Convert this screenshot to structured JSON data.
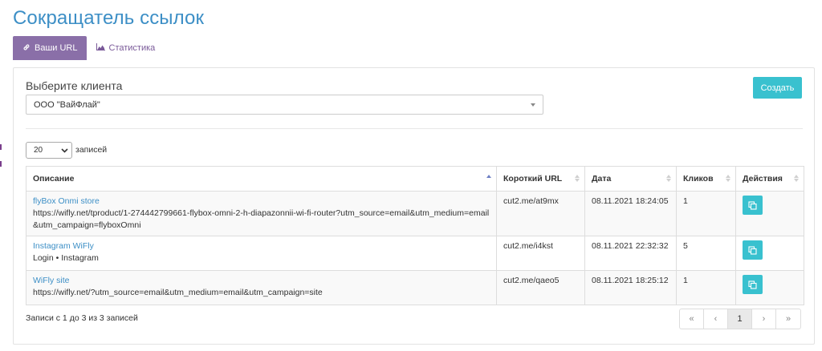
{
  "header": {
    "title": "Сокращатель ссылок"
  },
  "tabs": [
    {
      "label": "Ваши URL",
      "icon": "link-icon",
      "active": true
    },
    {
      "label": "Статистика",
      "icon": "area-chart-icon",
      "active": false
    }
  ],
  "client": {
    "label": "Выберите клиента",
    "selected": "ООО \"ВайФлай\""
  },
  "create_button": {
    "label": "Создать"
  },
  "length": {
    "value": "20",
    "suffix": "записей"
  },
  "table": {
    "columns": [
      {
        "label": "Описание",
        "sorted": "asc"
      },
      {
        "label": "Короткий URL"
      },
      {
        "label": "Дата"
      },
      {
        "label": "Кликов"
      },
      {
        "label": "Действия"
      }
    ],
    "rows": [
      {
        "title": "flyBox Onmi store",
        "desc": "https://wifly.net/tproduct/1-274442799661-flybox-omni-2-h-diapazonnii-wi-fi-router?utm_source=email&utm_medium=email&utm_campaign=flyboxOmni",
        "short_url": "cut2.me/at9mx",
        "date": "08.11.2021 18:24:05",
        "clicks": "1"
      },
      {
        "title": "Instagram WiFly",
        "desc": "Login • Instagram",
        "short_url": "cut2.me/i4kst",
        "date": "08.11.2021 22:32:32",
        "clicks": "5"
      },
      {
        "title": "WiFly site",
        "desc": "https://wifly.net/?utm_source=email&utm_medium=email&utm_campaign=site",
        "short_url": "cut2.me/qaeo5",
        "date": "08.11.2021 18:25:12",
        "clicks": "1"
      }
    ]
  },
  "info": "Записи с 1 до 3 из 3 записей",
  "pagination": {
    "first": "«",
    "prev": "‹",
    "current": "1",
    "next": "›",
    "last": "»"
  },
  "colors": {
    "title": "#3d8fc6",
    "active_tab": "#8a6fa8",
    "accent_button": "#39c1cf"
  }
}
